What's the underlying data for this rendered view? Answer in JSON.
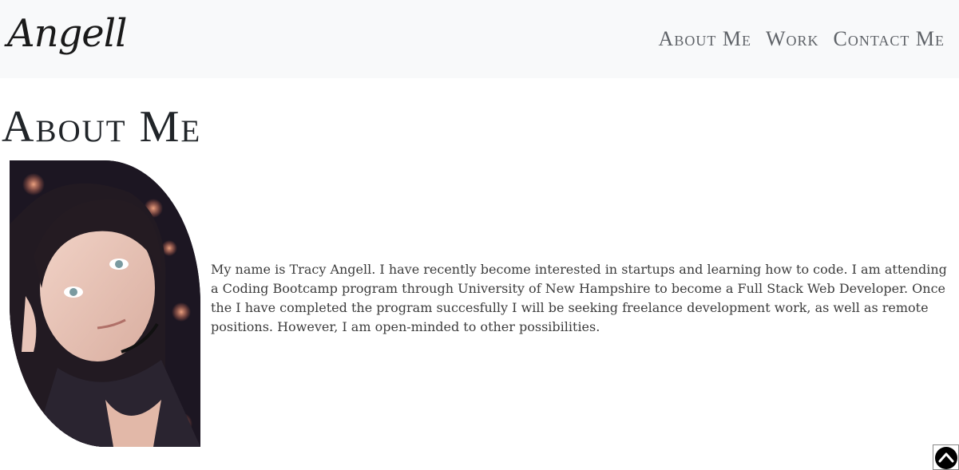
{
  "navbar": {
    "brand": "Angell",
    "links": [
      {
        "label": "About Me"
      },
      {
        "label": "Work"
      },
      {
        "label": "Contact Me"
      }
    ]
  },
  "main": {
    "title": "About Me",
    "photo": {
      "icon": "portrait-photo"
    },
    "bio": "My name is Tracy Angell. I have recently become interested in startups and learning how to code. I am attending a Coding Bootcamp program through University of New Hampshire to become a Full Stack Web Developer. Once the I have completed the program succesfully I will be seeking freelance development work, as well as remote positions. However, I am open-minded to other possibilities."
  },
  "scroll_top": {
    "icon": "chevron-up-circle-icon"
  },
  "colors": {
    "navbar_bg": "#f8f9fa",
    "nav_link": "#5f6368",
    "text": "#212529"
  }
}
